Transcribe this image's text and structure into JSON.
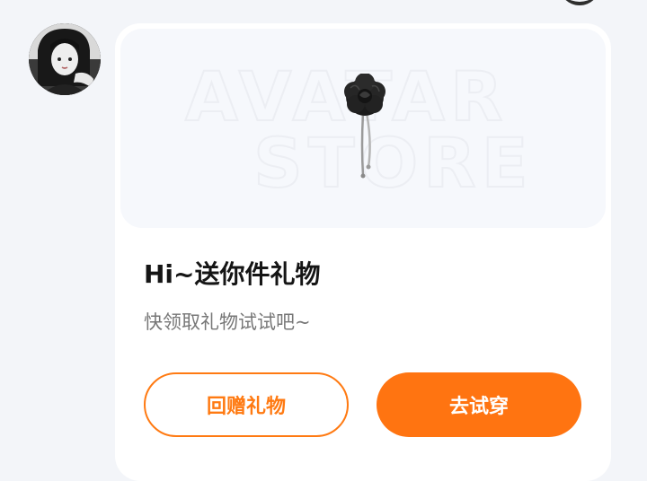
{
  "colors": {
    "accent": "#ff7411",
    "background": "#f3f5f9",
    "card": "#ffffff",
    "banner": "#f6f8fc"
  },
  "sender": {
    "avatar_icon": "user-avatar-photo"
  },
  "gift_card": {
    "banner": {
      "watermark_line1": "AVATAR",
      "watermark_line2": "STORE",
      "item_icon": "black-camellia-brooch-icon"
    },
    "title": "Hi~送你件礼物",
    "subtitle": "快领取礼物试试吧~",
    "buttons": {
      "return_gift": "回赠礼物",
      "try_on": "去试穿"
    }
  }
}
